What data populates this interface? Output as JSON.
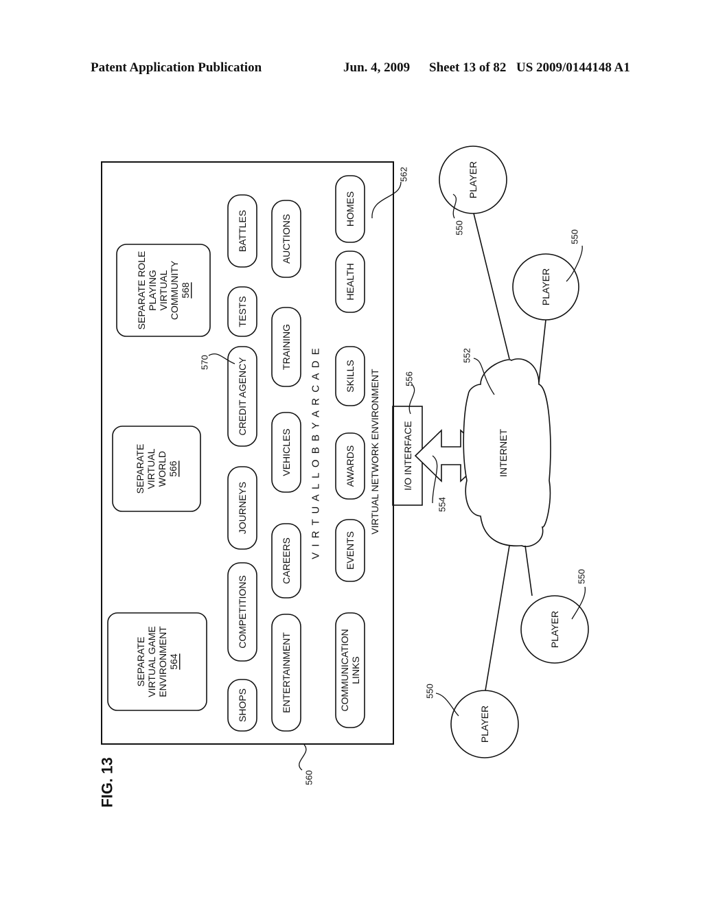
{
  "header": {
    "publication": "Patent Application Publication",
    "date": "Jun. 4, 2009",
    "sheet": "Sheet 13 of 82",
    "number": "US 2009/0144148 A1"
  },
  "figure": {
    "label": "FIG. 13",
    "outer_box_ref": "560",
    "network_env_label": "VIRTUAL NETWORK ENVIRONMENT",
    "lobby_label": "V I R T U A L   L O B B Y   A R C A D E",
    "lobby_ref": "562",
    "separate_boxes": [
      {
        "lines": [
          "SEPARATE",
          "VIRTUAL GAME",
          "ENVIRONMENT"
        ],
        "ref": "564"
      },
      {
        "lines": [
          "SEPARATE",
          "VIRTUAL",
          "WORLD"
        ],
        "ref": "566"
      },
      {
        "lines": [
          "SEPARATE ROLE",
          "PLAYING",
          "VIRTUAL",
          "COMMUNITY"
        ],
        "ref": "568"
      }
    ],
    "pills_row1": [
      "SHOPS",
      "COMPETITIONS",
      "JOURNEYS",
      "CREDIT AGENCY",
      "TESTS",
      "BATTLES"
    ],
    "pills_row2": [
      "ENTERTAINMENT",
      "CAREERS",
      "VEHICLES",
      "TRAINING",
      "AUCTIONS"
    ],
    "pills_row3": [
      "COMMUNICATION|LINKS",
      "EVENTS",
      "AWARDS",
      "SKILLS",
      "HEALTH",
      "HOMES"
    ],
    "credit_agency_ref": "570",
    "io_interface": {
      "label": "I/O INTERFACE",
      "ref": "556"
    },
    "arrow_ref": "554",
    "internet": {
      "label": "INTERNET",
      "ref": "552"
    },
    "players": [
      {
        "label": "PLAYER",
        "ref": "550"
      },
      {
        "label": "PLAYER",
        "ref": "550"
      },
      {
        "label": "PLAYER",
        "ref": "550"
      },
      {
        "label": "PLAYER",
        "ref": "550"
      }
    ]
  }
}
